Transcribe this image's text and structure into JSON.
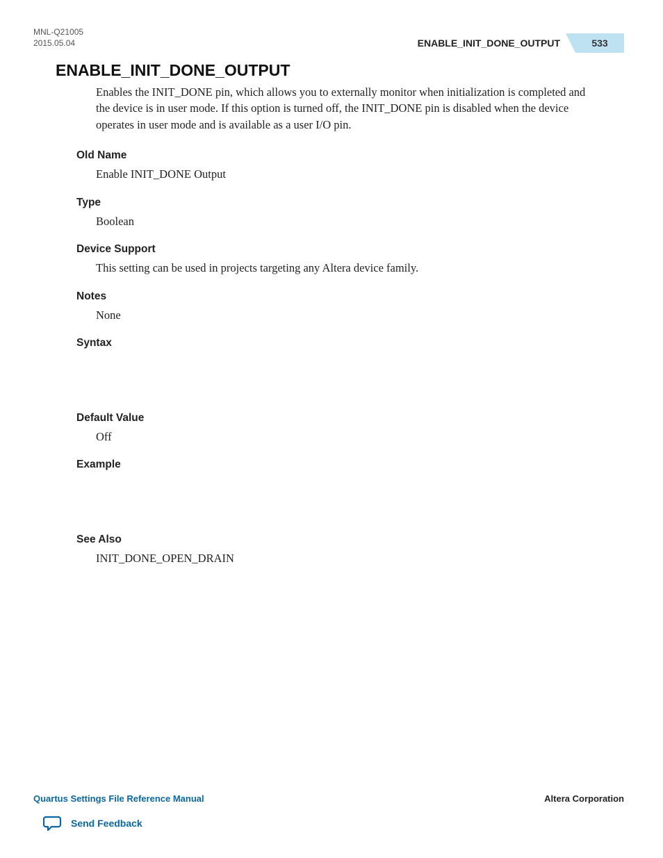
{
  "header": {
    "doc_id_line1": "MNL-Q21005",
    "doc_id_line2": "2015.05.04",
    "section_name": "ENABLE_INIT_DONE_OUTPUT",
    "page_number": "533"
  },
  "title": "ENABLE_INIT_DONE_OUTPUT",
  "intro": "Enables the INIT_DONE pin, which allows you to externally monitor when initialization is completed and the device is in user mode. If this option is turned off, the INIT_DONE pin is disabled when the device operates in user mode and is available as a user I/O pin.",
  "sections": {
    "old_name": {
      "label": "Old Name",
      "value": "Enable INIT_DONE Output"
    },
    "type": {
      "label": "Type",
      "value": "Boolean"
    },
    "device_support": {
      "label": "Device Support",
      "value": "This setting can be used in projects targeting any Altera device family."
    },
    "notes": {
      "label": "Notes",
      "value": "None"
    },
    "syntax": {
      "label": "Syntax",
      "value": ""
    },
    "default_value": {
      "label": "Default Value",
      "value": "Off"
    },
    "example": {
      "label": "Example",
      "value": ""
    },
    "see_also": {
      "label": "See Also",
      "value": "INIT_DONE_OPEN_DRAIN"
    }
  },
  "footer": {
    "manual_name": "Quartus Settings File Reference Manual",
    "company": "Altera Corporation",
    "feedback_label": "Send Feedback"
  }
}
